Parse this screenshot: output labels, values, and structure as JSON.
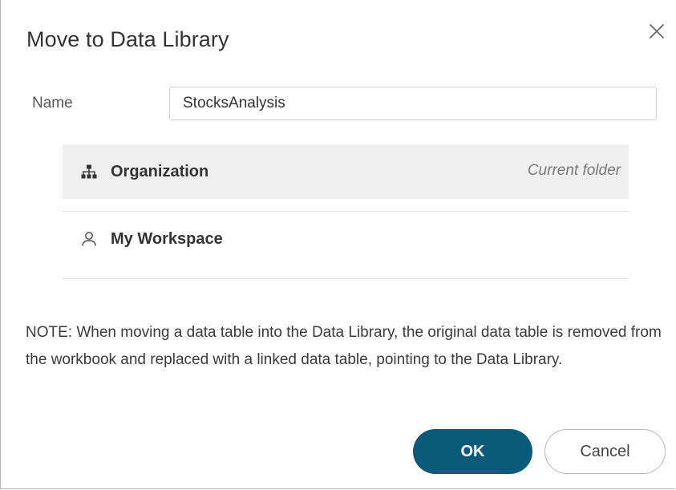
{
  "dialog": {
    "title": "Move to Data Library",
    "close_icon": "close-icon"
  },
  "form": {
    "name_label": "Name",
    "name_value": "StocksAnalysis"
  },
  "folders": [
    {
      "icon": "organization-icon",
      "label": "Organization",
      "hint": "Current folder",
      "selected": true
    },
    {
      "icon": "user-icon",
      "label": "My Workspace",
      "hint": "",
      "selected": false
    }
  ],
  "note": "NOTE: When moving a data table into the Data Library, the original data table is removed from the workbook and replaced with a linked data table, pointing to the Data Library.",
  "buttons": {
    "ok_label": "OK",
    "cancel_label": "Cancel"
  },
  "colors": {
    "primary": "#0a5a7a",
    "selected_row": "#efefef"
  }
}
